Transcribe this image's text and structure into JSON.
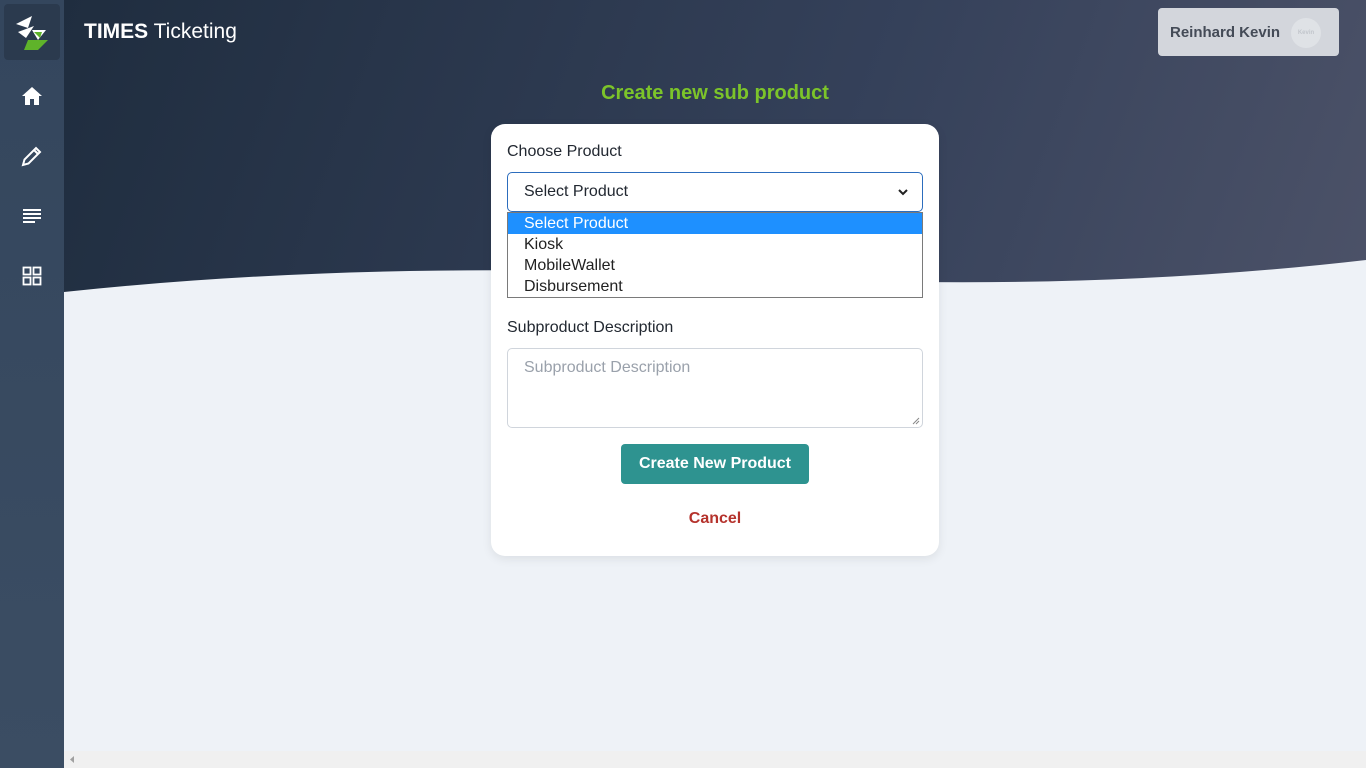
{
  "app": {
    "brand_bold": "TIMES",
    "brand_rest": " Ticketing"
  },
  "sidebar": {
    "items": [
      {
        "icon": "home-icon"
      },
      {
        "icon": "pencil-icon"
      },
      {
        "icon": "list-icon"
      },
      {
        "icon": "grid-icon"
      }
    ]
  },
  "user": {
    "name": "Reinhard Kevin",
    "avatar_text": "Kevin"
  },
  "form": {
    "title": "Create new sub product",
    "product_label": "Choose Product",
    "product_selected": "Select Product",
    "product_options": [
      "Select Product",
      "Kiosk",
      "MobileWallet",
      "Disbursement"
    ],
    "description_label": "Subproduct Description",
    "description_placeholder": "Subproduct Description",
    "create_button": "Create New Product",
    "cancel_button": "Cancel"
  },
  "colors": {
    "title_green": "#7cc42a",
    "button_teal": "#2e9390",
    "cancel_red": "#b5322c",
    "selected_blue": "#1e90ff"
  }
}
